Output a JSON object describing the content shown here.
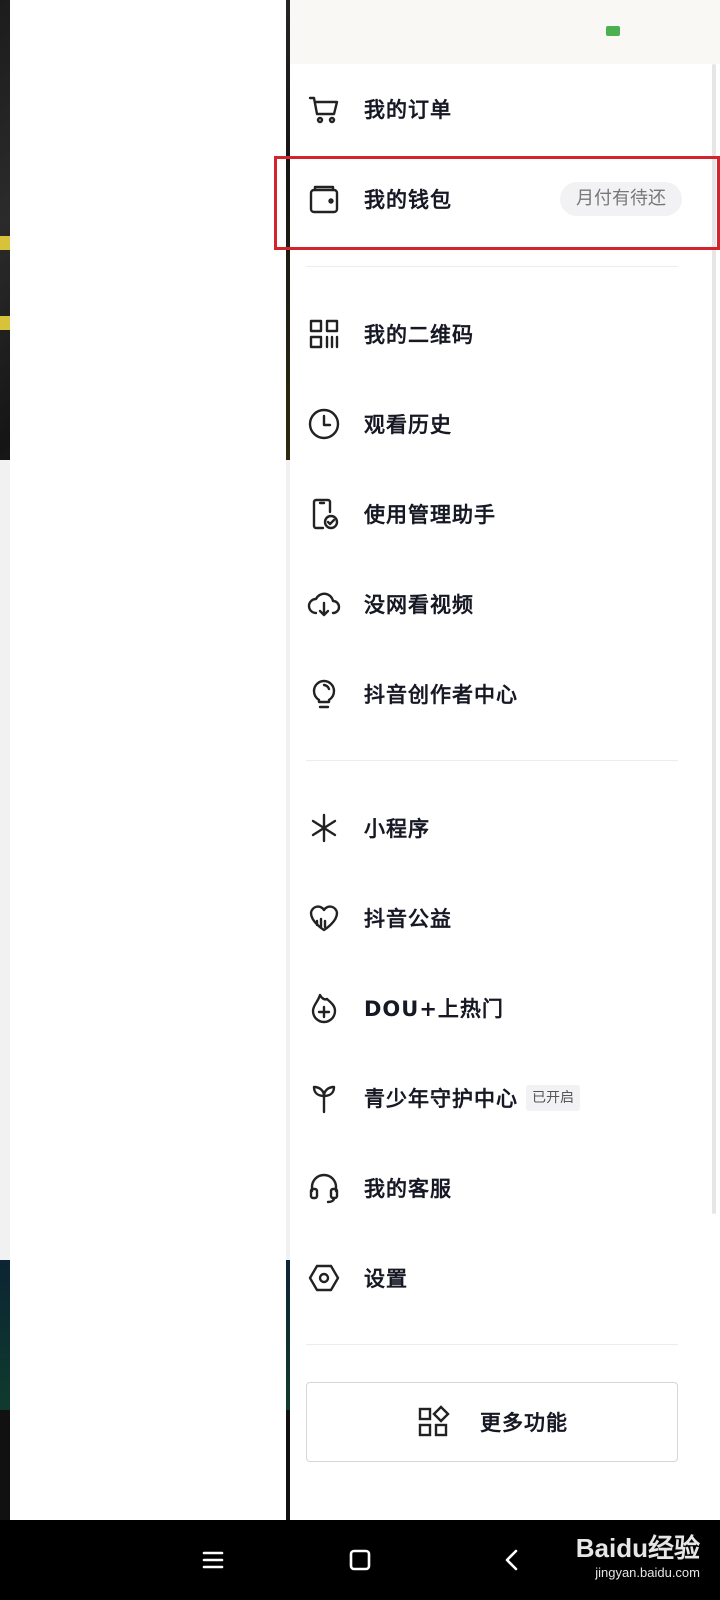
{
  "drawer": {
    "group1": [
      {
        "label": "我的订单",
        "icon": "cart-icon"
      },
      {
        "label": "我的钱包",
        "icon": "wallet-icon",
        "badge": "月付有待还"
      }
    ],
    "group2": [
      {
        "label": "我的二维码",
        "icon": "qrcode-icon"
      },
      {
        "label": "观看历史",
        "icon": "clock-icon"
      },
      {
        "label": "使用管理助手",
        "icon": "phone-check-icon"
      },
      {
        "label": "没网看视频",
        "icon": "cloud-download-icon"
      },
      {
        "label": "抖音创作者中心",
        "icon": "lightbulb-icon"
      }
    ],
    "group3": [
      {
        "label": "小程序",
        "icon": "miniapp-icon"
      },
      {
        "label": "抖音公益",
        "icon": "heart-icon"
      },
      {
        "label": "DOU+上热门",
        "icon": "flame-plus-icon"
      },
      {
        "label": "青少年守护中心",
        "icon": "sprout-icon",
        "badge": "已开启"
      },
      {
        "label": "我的客服",
        "icon": "headset-icon"
      },
      {
        "label": "设置",
        "icon": "gear-hex-icon"
      }
    ],
    "more_button": "更多功能"
  },
  "watermark": {
    "logo": "Baidu经验",
    "url": "jingyan.baidu.com"
  },
  "colors": {
    "highlight": "#d2242d",
    "text": "#161823",
    "badge_bg": "#f2f2f4"
  }
}
